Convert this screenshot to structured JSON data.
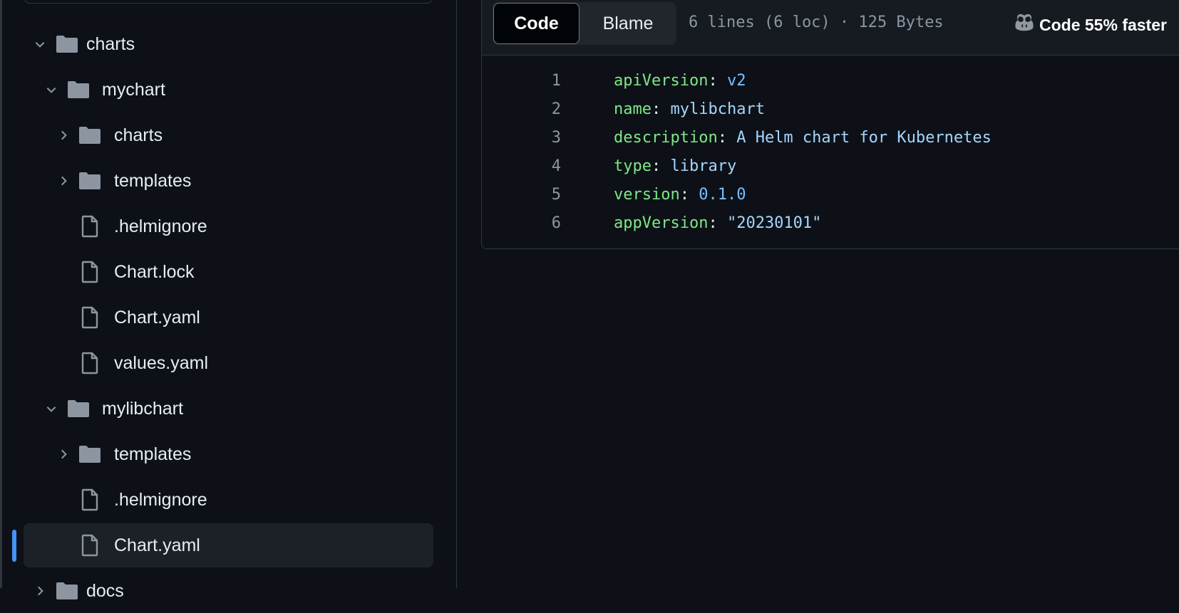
{
  "tree": [
    {
      "label": "charts",
      "type": "folder",
      "level": 0,
      "expanded": true
    },
    {
      "label": "mychart",
      "type": "folder",
      "level": 1,
      "expanded": true
    },
    {
      "label": "charts",
      "type": "folder",
      "level": 2,
      "expanded": false
    },
    {
      "label": "templates",
      "type": "folder",
      "level": 2,
      "expanded": false
    },
    {
      "label": ".helmignore",
      "type": "file",
      "level": 2
    },
    {
      "label": "Chart.lock",
      "type": "file",
      "level": 2
    },
    {
      "label": "Chart.yaml",
      "type": "file",
      "level": 2
    },
    {
      "label": "values.yaml",
      "type": "file",
      "level": 2
    },
    {
      "label": "mylibchart",
      "type": "folder",
      "level": 1,
      "expanded": true
    },
    {
      "label": "templates",
      "type": "folder",
      "level": 2,
      "expanded": false
    },
    {
      "label": ".helmignore",
      "type": "file",
      "level": 2
    },
    {
      "label": "Chart.yaml",
      "type": "file",
      "level": 2,
      "selected": true
    },
    {
      "label": "docs",
      "type": "folder",
      "level": 0,
      "expanded": false
    }
  ],
  "header": {
    "code_tab": "Code",
    "blame_tab": "Blame",
    "file_meta": "6 lines (6 loc) · 125 Bytes",
    "copilot_icon": "copilot-icon",
    "copilot_text": "Code 55% faster"
  },
  "code_lines": [
    {
      "num": "1",
      "key": "apiVersion",
      "value": "v2",
      "kind": "c"
    },
    {
      "num": "2",
      "key": "name",
      "value": "mylibchart",
      "kind": "s"
    },
    {
      "num": "3",
      "key": "description",
      "value": "A Helm chart for Kubernetes",
      "kind": "s"
    },
    {
      "num": "4",
      "key": "type",
      "value": "library",
      "kind": "s"
    },
    {
      "num": "5",
      "key": "version",
      "value": "0.1.0",
      "kind": "c"
    },
    {
      "num": "6",
      "key": "appVersion",
      "value": "\"20230101\"",
      "kind": "s"
    }
  ],
  "colors": {
    "accent": "#4493f8",
    "key": "#7ee787",
    "string": "#a5d6ff",
    "constant": "#79c0ff",
    "background": "#0d1117"
  }
}
